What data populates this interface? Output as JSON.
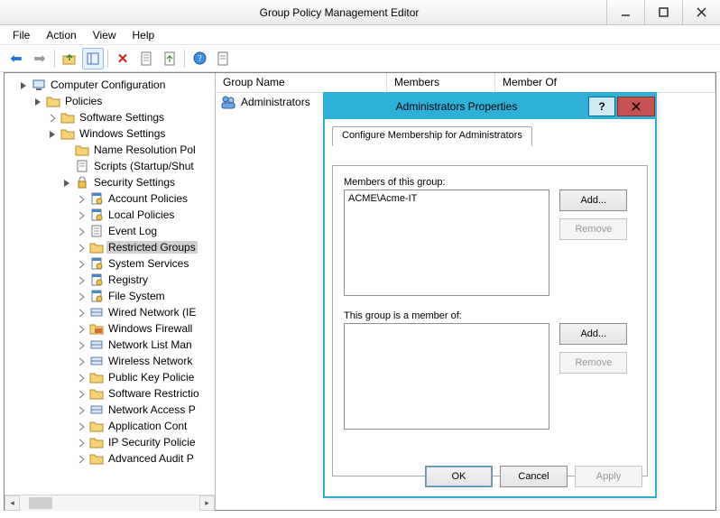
{
  "window": {
    "title": "Group Policy Management Editor",
    "menus": [
      "File",
      "Action",
      "View",
      "Help"
    ]
  },
  "toolbar_icons": [
    "back",
    "forward",
    "up",
    "frame",
    "delete",
    "refresh",
    "export",
    "help",
    "detail"
  ],
  "tree": {
    "root": "Computer Configuration",
    "policies": "Policies",
    "software": "Software Settings",
    "windows": "Windows Settings",
    "nrp": "Name Resolution Pol",
    "scripts": "Scripts (Startup/Shut",
    "security": "Security Settings",
    "items": [
      "Account Policies",
      "Local Policies",
      "Event Log",
      "Restricted Groups",
      "System Services",
      "Registry",
      "File System",
      "Wired Network (IE",
      "Windows Firewall",
      "Network List Man",
      "Wireless Network",
      "Public Key Policie",
      "Software Restrictio",
      "Network Access P",
      "Application Cont",
      "IP Security Policie",
      "Advanced Audit P"
    ]
  },
  "list": {
    "columns": [
      "Group Name",
      "Members",
      "Member Of"
    ],
    "row0": "Administrators",
    "row0_icon": "users-icon"
  },
  "dialog": {
    "title": "Administrators Properties",
    "tab": "Configure Membership for Administrators",
    "members_label": "Members of this group:",
    "memberof_label": "This group is a member of:",
    "members": [
      "ACME\\Acme-IT"
    ],
    "add": "Add...",
    "remove": "Remove",
    "ok": "OK",
    "cancel": "Cancel",
    "apply": "Apply",
    "help": "?"
  }
}
